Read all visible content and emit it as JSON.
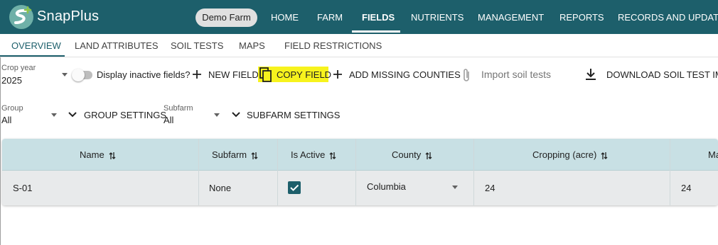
{
  "app": {
    "brand": "SnapPlus",
    "farm_chip": "Demo Farm",
    "accent": "#1d5f6b"
  },
  "nav": {
    "items": [
      "HOME",
      "FARM",
      "FIELDS",
      "NUTRIENTS",
      "MANAGEMENT",
      "REPORTS",
      "RECORDS AND UPDATES"
    ],
    "active": "FIELDS"
  },
  "subtabs": {
    "items": [
      "OVERVIEW",
      "LAND ATTRIBUTES",
      "SOIL TESTS",
      "MAPS",
      "FIELD RESTRICTIONS"
    ],
    "active": "OVERVIEW"
  },
  "toolbar": {
    "crop_year_label": "Crop year",
    "crop_year_value": "2025",
    "inactive_toggle_label": "Display inactive fields?",
    "inactive_toggle_on": false,
    "new_field": "NEW FIELD",
    "copy_field": "COPY FIELD",
    "add_missing_counties": "ADD MISSING COUNTIES",
    "import_soil_tests": "Import soil tests",
    "download_soil_test": "DOWNLOAD SOIL TEST IMPO",
    "group_label": "Group",
    "group_value": "All",
    "group_settings": "GROUP SETTINGS",
    "subfarm_label": "Subfarm",
    "subfarm_value": "All",
    "subfarm_settings": "SUBFARM SETTINGS",
    "highlight_color": "#f7f31d"
  },
  "table": {
    "columns": [
      "Name",
      "Subfarm",
      "Is Active",
      "County",
      "Cropping (acre)",
      "Ma"
    ],
    "rows": [
      {
        "name": "S-01",
        "subfarm": "None",
        "is_active": true,
        "county": "Columbia",
        "cropping": "24",
        "ma": "24"
      }
    ]
  }
}
